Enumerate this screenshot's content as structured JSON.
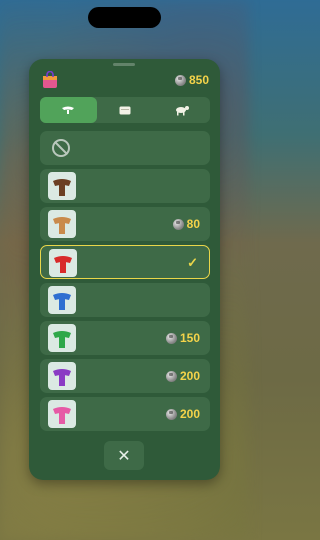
{
  "header": {
    "shop_icon": "shopping-bag-icon",
    "balance_icon": "coin-icon",
    "balance": "850"
  },
  "tabs": [
    {
      "name": "saddle-tab",
      "icon": "saddle-icon",
      "active": true
    },
    {
      "name": "blanket-tab",
      "icon": "blanket-icon",
      "active": false
    },
    {
      "name": "animal-tab",
      "icon": "goat-icon",
      "active": false
    }
  ],
  "items": [
    {
      "kind": "none",
      "icon": "prohibited-icon",
      "price": "",
      "selected": false
    },
    {
      "kind": "saddle",
      "color": "#6b3f23",
      "price": "",
      "selected": false
    },
    {
      "kind": "saddle",
      "color": "#c98a4b",
      "price": "80",
      "selected": false
    },
    {
      "kind": "saddle",
      "color": "#d82a2a",
      "price": "",
      "selected": true,
      "check": "✓"
    },
    {
      "kind": "saddle",
      "color": "#2f6fd1",
      "price": "",
      "selected": false
    },
    {
      "kind": "saddle",
      "color": "#2fa84a",
      "price": "150",
      "selected": false
    },
    {
      "kind": "saddle",
      "color": "#8a3bc4",
      "price": "200",
      "selected": false
    },
    {
      "kind": "saddle",
      "color": "#e65aa6",
      "price": "200",
      "selected": false
    }
  ],
  "close_button": {
    "icon": "close-icon",
    "glyph": "✕"
  },
  "colors": {
    "accent": "#e9d64a",
    "price": "#f4d34a",
    "panel": "#2f5a39",
    "row": "#3e6a47",
    "active_tab": "#51a35a"
  }
}
